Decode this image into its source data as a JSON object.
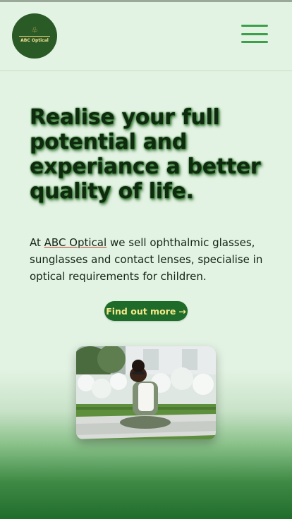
{
  "header": {
    "logo_text": "ABC Optical",
    "menu_icon": "hamburger-menu-icon"
  },
  "hero": {
    "title": "Realise your full potential and experiance a better quality of life.",
    "intro_prefix": "At ",
    "intro_link": "ABC Optical",
    "intro_suffix": " we sell ophthalmic glasses, sunglasses and contact lenses, specialise in optical requirements for children.",
    "cta_label": "Find out more",
    "cta_icon": "arrow-right-icon"
  },
  "colors": {
    "background": "#e3f3e3",
    "brand_green": "#1f6b2a",
    "accent_green": "#3aa14a",
    "cta_text": "#f5e88a"
  }
}
